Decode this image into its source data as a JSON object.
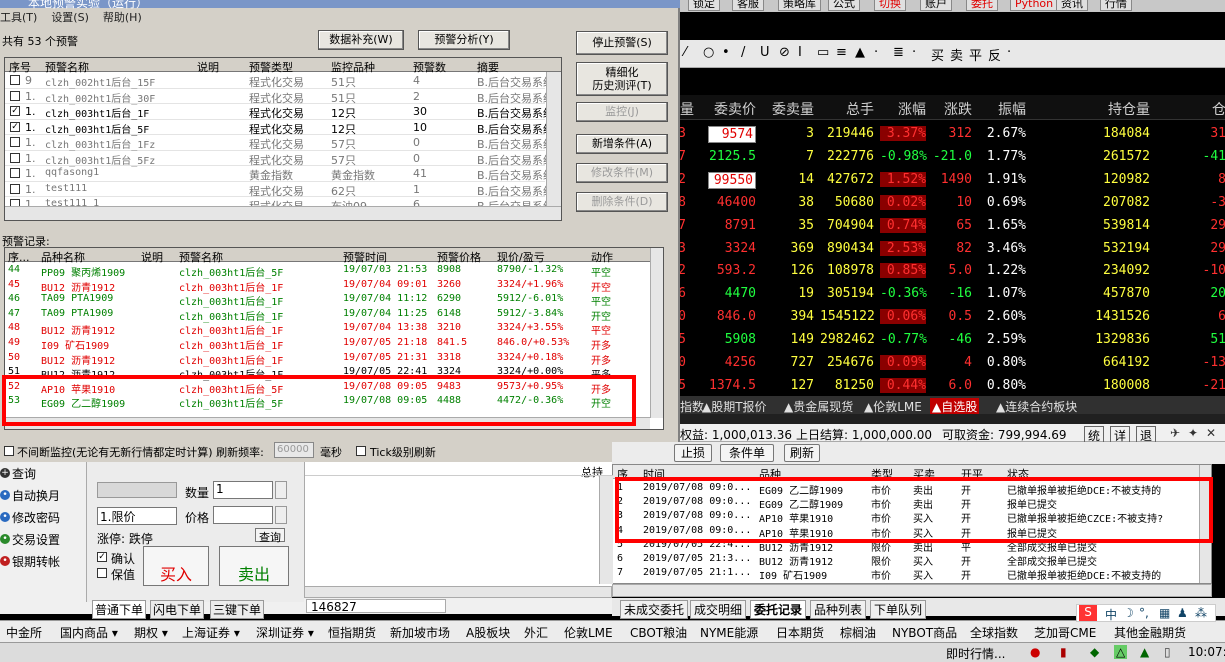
{
  "dialog": {
    "title": "本地预警实验（运行）",
    "menu": [
      "工具(T)",
      "设置(S)",
      "帮助(H)"
    ],
    "count_label": "共有 53 个预警",
    "btn_supplement": "数据补充(W)",
    "btn_analysis": "预警分析(Y)",
    "btn_stop": "停止预警(S)",
    "btn_refine": "精细化\n历史测评(T)",
    "btn_monitor": "监控(J)",
    "btn_add": "新增条件(A)",
    "btn_modify": "修改条件(M)",
    "btn_delete": "删除条件(D)",
    "grid1_headers": [
      "序号",
      "预警名称",
      "说明",
      "预警类型",
      "监控品种",
      "预警数",
      "摘要"
    ],
    "grid1_rows": [
      {
        "checked": false,
        "no": "9",
        "name": "clzh_002ht1后台_15F",
        "type": "程式化交易",
        "variety": "51只",
        "count": "4",
        "summary": "B.后台交易系统",
        "dim": true
      },
      {
        "checked": false,
        "no": "1.",
        "name": "clzh_002ht1后台_30F",
        "type": "程式化交易",
        "variety": "51只",
        "count": "2",
        "summary": "B.后台交易系统",
        "dim": true
      },
      {
        "checked": true,
        "no": "1.",
        "name": "clzh_003ht1后台_1F",
        "type": "程式化交易",
        "variety": "12只",
        "count": "30",
        "summary": "B.后台交易系统",
        "dim": false
      },
      {
        "checked": true,
        "no": "1.",
        "name": "clzh_003ht1后台_5F",
        "type": "程式化交易",
        "variety": "12只",
        "count": "10",
        "summary": "B.后台交易系统",
        "dim": false
      },
      {
        "checked": false,
        "no": "1.",
        "name": "clzh_003ht1后台_1Fz",
        "type": "程式化交易",
        "variety": "57只",
        "count": "0",
        "summary": "B.后台交易系统",
        "dim": true
      },
      {
        "checked": false,
        "no": "1.",
        "name": "clzh_003ht1后台_5Fz",
        "type": "程式化交易",
        "variety": "57只",
        "count": "0",
        "summary": "B.后台交易系统",
        "dim": true
      },
      {
        "checked": false,
        "no": "1.",
        "name": "qqfasong1",
        "type": "黄金指数",
        "variety": "黄金指数",
        "count": "41",
        "summary": "B.后台交易系统",
        "dim": true
      },
      {
        "checked": false,
        "no": "1.",
        "name": "test111",
        "type": "程式化交易",
        "variety": "62只",
        "count": "1",
        "summary": "B.后台交易系统",
        "dim": true
      },
      {
        "checked": false,
        "no": "1.",
        "name": "test111_1",
        "type": "程式化交易",
        "variety": "布油09",
        "count": "6",
        "summary": "B.后台交易系统",
        "dim": true
      }
    ],
    "records_label": "预警记录:",
    "grid2_headers": [
      "序...",
      "品种名称",
      "说明",
      "预警名称",
      "预警时间",
      "预警价格",
      "现价/盈亏",
      "动作"
    ],
    "grid2_rows": [
      {
        "no": "44",
        "variety": "PP09 聚丙烯1909",
        "name": "clzh_003ht1后台_5F",
        "time": "19/07/03 21:53",
        "price": "8908",
        "cur": "8790/-1.32%",
        "action": "平空",
        "color": "#008000"
      },
      {
        "no": "45",
        "variety": "BU12 沥青1912",
        "name": "clzh_003ht1后台_1F",
        "time": "19/07/04 09:01",
        "price": "3260",
        "cur": "3324/+1.96%",
        "action": "开空",
        "color": "#e00000"
      },
      {
        "no": "46",
        "variety": "TA09 PTA1909",
        "name": "clzh_003ht1后台_1F",
        "time": "19/07/04 11:12",
        "price": "6290",
        "cur": "5912/-6.01%",
        "action": "平空",
        "color": "#008000"
      },
      {
        "no": "47",
        "variety": "TA09 PTA1909",
        "name": "clzh_003ht1后台_1F",
        "time": "19/07/04 11:25",
        "price": "6148",
        "cur": "5912/-3.84%",
        "action": "开空",
        "color": "#008000"
      },
      {
        "no": "48",
        "variety": "BU12 沥青1912",
        "name": "clzh_003ht1后台_1F",
        "time": "19/07/04 13:38",
        "price": "3210",
        "cur": "3324/+3.55%",
        "action": "平空",
        "color": "#e00000"
      },
      {
        "no": "49",
        "variety": "I09 矿石1909",
        "name": "clzh_003ht1后台_1F",
        "time": "19/07/05 21:18",
        "price": "841.5",
        "cur": "846.0/+0.53%",
        "action": "开多",
        "color": "#e00000"
      },
      {
        "no": "50",
        "variety": "BU12 沥青1912",
        "name": "clzh_003ht1后台_1F",
        "time": "19/07/05 21:31",
        "price": "3318",
        "cur": "3324/+0.18%",
        "action": "开多",
        "color": "#e00000"
      },
      {
        "no": "51",
        "variety": "BU12 沥青1912",
        "name": "clzh_003ht1后台_1F",
        "time": "19/07/05 22:41",
        "price": "3324",
        "cur": "3324/+0.00%",
        "action": "平多",
        "color": "#000000"
      },
      {
        "no": "52",
        "variety": "AP10 苹果1910",
        "name": "clzh_003ht1后台_5F",
        "time": "19/07/08 09:05",
        "price": "9483",
        "cur": "9573/+0.95%",
        "action": "开多",
        "color": "#e00000"
      },
      {
        "no": "53",
        "variety": "EG09 乙二醇1909",
        "name": "clzh_003ht1后台_5F",
        "time": "19/07/08 09:05",
        "price": "4488",
        "cur": "4472/-0.36%",
        "action": "开空",
        "color": "#008000"
      }
    ],
    "continuous_label": "不间断监控(无论有无新行情都定时计算) 刷新频率:",
    "refresh_value": "60000",
    "ms_label": "毫秒",
    "tick_label": "Tick级别刷新"
  },
  "topbar": [
    "锁定",
    "客服",
    "策略库",
    "公式",
    "切换",
    "账户",
    "委托",
    "Python",
    "资讯",
    "行情"
  ],
  "drawbar": [
    "⁄",
    "○",
    "•",
    "/",
    "U",
    "⊘",
    "Ⅰ",
    "▭",
    "≡",
    "▲",
    "·",
    "≣",
    "·",
    "买",
    "卖",
    "平",
    "反",
    "·"
  ],
  "quote": {
    "headers": [
      "量",
      "委卖价",
      "委卖量",
      "总手",
      "涨幅",
      "涨跌",
      "振幅",
      "持仓量",
      "仓"
    ],
    "rows": [
      {
        "q": "3",
        "ask": "9574",
        "askv": "3",
        "vol": "219446",
        "pct": "3.37%",
        "chg": "312",
        "amp": "2.67%",
        "oi": "184084",
        "x": "31",
        "cls": "c-red",
        "boxed": true
      },
      {
        "q": "7",
        "ask": "2125.5",
        "askv": "7",
        "vol": "222776",
        "pct": "-0.98%",
        "chg": "-21.0",
        "amp": "1.77%",
        "oi": "261572",
        "x": "-41",
        "cls": "c-grn",
        "boxed": false
      },
      {
        "q": "2",
        "ask": "99550",
        "askv": "14",
        "vol": "427672",
        "pct": "1.52%",
        "chg": "1490",
        "amp": "1.91%",
        "oi": "120982",
        "x": "8",
        "cls": "c-red",
        "boxed": true
      },
      {
        "q": "8",
        "ask": "46400",
        "askv": "38",
        "vol": "50680",
        "pct": "0.02%",
        "chg": "10",
        "amp": "0.69%",
        "oi": "207082",
        "x": "-3",
        "cls": "c-red",
        "boxed": false
      },
      {
        "q": "7",
        "ask": "8791",
        "askv": "35",
        "vol": "704904",
        "pct": "0.74%",
        "chg": "65",
        "amp": "1.65%",
        "oi": "539814",
        "x": "29",
        "cls": "c-red",
        "boxed": false
      },
      {
        "q": "3",
        "ask": "3324",
        "askv": "369",
        "vol": "890434",
        "pct": "2.53%",
        "chg": "82",
        "amp": "3.46%",
        "oi": "532194",
        "x": "29",
        "cls": "c-red",
        "boxed": false
      },
      {
        "q": "2",
        "ask": "593.2",
        "askv": "126",
        "vol": "108978",
        "pct": "0.85%",
        "chg": "5.0",
        "amp": "1.22%",
        "oi": "234092",
        "x": "-10",
        "cls": "c-red",
        "boxed": false
      },
      {
        "q": "6",
        "ask": "4470",
        "askv": "19",
        "vol": "305194",
        "pct": "-0.36%",
        "chg": "-16",
        "amp": "1.07%",
        "oi": "457870",
        "x": "20",
        "cls": "c-grn",
        "boxed": false
      },
      {
        "q": "0",
        "ask": "846.0",
        "askv": "394",
        "vol": "1545122",
        "pct": "0.06%",
        "chg": "0.5",
        "amp": "2.60%",
        "oi": "1431526",
        "x": "6",
        "cls": "c-red",
        "boxed": false
      },
      {
        "q": "5",
        "ask": "5908",
        "askv": "149",
        "vol": "2982462",
        "pct": "-0.77%",
        "chg": "-46",
        "amp": "2.59%",
        "oi": "1329836",
        "x": "51",
        "cls": "c-grn",
        "boxed": false
      },
      {
        "q": "0",
        "ask": "4256",
        "askv": "727",
        "vol": "254676",
        "pct": "0.09%",
        "chg": "4",
        "amp": "0.80%",
        "oi": "664192",
        "x": "-13",
        "cls": "c-red",
        "boxed": false
      },
      {
        "q": "5",
        "ask": "1374.5",
        "askv": "127",
        "vol": "81250",
        "pct": "0.44%",
        "chg": "6.0",
        "amp": "0.80%",
        "oi": "180008",
        "x": "-21",
        "cls": "c-red",
        "boxed": false
      }
    ],
    "tabs": [
      "指数",
      "▲股期T报价",
      "▲贵金属现货",
      "▲伦敦LME",
      "▲自选股",
      "▲连续合约板块"
    ]
  },
  "account": {
    "equity": "权益: 1,000,013.36",
    "settle": "上日结算: 1,000,000.00",
    "available": "可取资金: 799,994.69",
    "buttons": [
      "统",
      "详",
      "退"
    ]
  },
  "orderbar": {
    "b1": "止损",
    "b2": "条件单",
    "b3": "刷新"
  },
  "orders": {
    "headers": [
      "序",
      "时间",
      "品种",
      "类型",
      "买卖",
      "开平",
      "状态"
    ],
    "rows": [
      {
        "no": "1",
        "time": "2019/07/08 09:0...",
        "var": "EG09 乙二醇1909",
        "type": "市价",
        "side": "卖出",
        "oc": "开",
        "status": "已撤单报单被拒绝DCE:不被支持的"
      },
      {
        "no": "2",
        "time": "2019/07/08 09:0...",
        "var": "EG09 乙二醇1909",
        "type": "市价",
        "side": "卖出",
        "oc": "开",
        "status": "报单已提交"
      },
      {
        "no": "3",
        "time": "2019/07/08 09:0...",
        "var": "AP10 苹果1910",
        "type": "市价",
        "side": "买入",
        "oc": "开",
        "status": "已撤单报单被拒绝CZCE:不被支持?"
      },
      {
        "no": "4",
        "time": "2019/07/08 09:0...",
        "var": "AP10 苹果1910",
        "type": "市价",
        "side": "买入",
        "oc": "开",
        "status": "报单已提交"
      },
      {
        "no": "5",
        "time": "2019/07/05 22:4...",
        "var": "BU12 沥青1912",
        "type": "限价",
        "side": "卖出",
        "oc": "平",
        "status": "全部成交报单已提交"
      },
      {
        "no": "6",
        "time": "2019/07/05 21:3...",
        "var": "BU12 沥青1912",
        "type": "限价",
        "side": "买入",
        "oc": "开",
        "status": "全部成交报单已提交"
      },
      {
        "no": "7",
        "time": "2019/07/05 21:1...",
        "var": "I09 矿石1909",
        "type": "市价",
        "side": "买入",
        "oc": "开",
        "status": "已撤单报单被拒绝DCE:不被支持的"
      }
    ],
    "tabs": [
      "未成交委托",
      "成交明细",
      "委托记录",
      "品种列表",
      "下单队列"
    ]
  },
  "leftpanel": {
    "nav": [
      "查询",
      "自动换月",
      "修改密码",
      "交易设置",
      "银期转帐"
    ],
    "qty_label": "数量",
    "qty_value": "1",
    "price_type": "1.限价",
    "price_label": "价格",
    "limit_label": "涨停: 跌停",
    "query_btn": "查询",
    "confirm": "确认",
    "keep": "保值",
    "buy": "买入",
    "sell": "卖出",
    "col_hold": "总持",
    "tabs": [
      "普通下单",
      "闪电下单",
      "三键下单"
    ],
    "code": "146827"
  },
  "bottomtabs": [
    "中金所",
    "国内商品 ▾",
    "期权 ▾",
    "上海证券 ▾",
    "深圳证券 ▾",
    "恒指期货",
    "新加坡市场",
    "A股板块",
    "外汇",
    "伦敦LME",
    "CBOT粮油",
    "NYME能源",
    "日本期货",
    "棕榈油",
    "NYBOT商品",
    "全球指数",
    "芝加哥CME",
    "其他金融期货"
  ],
  "status": {
    "text": "即时行情...",
    "time": "10:07:"
  }
}
